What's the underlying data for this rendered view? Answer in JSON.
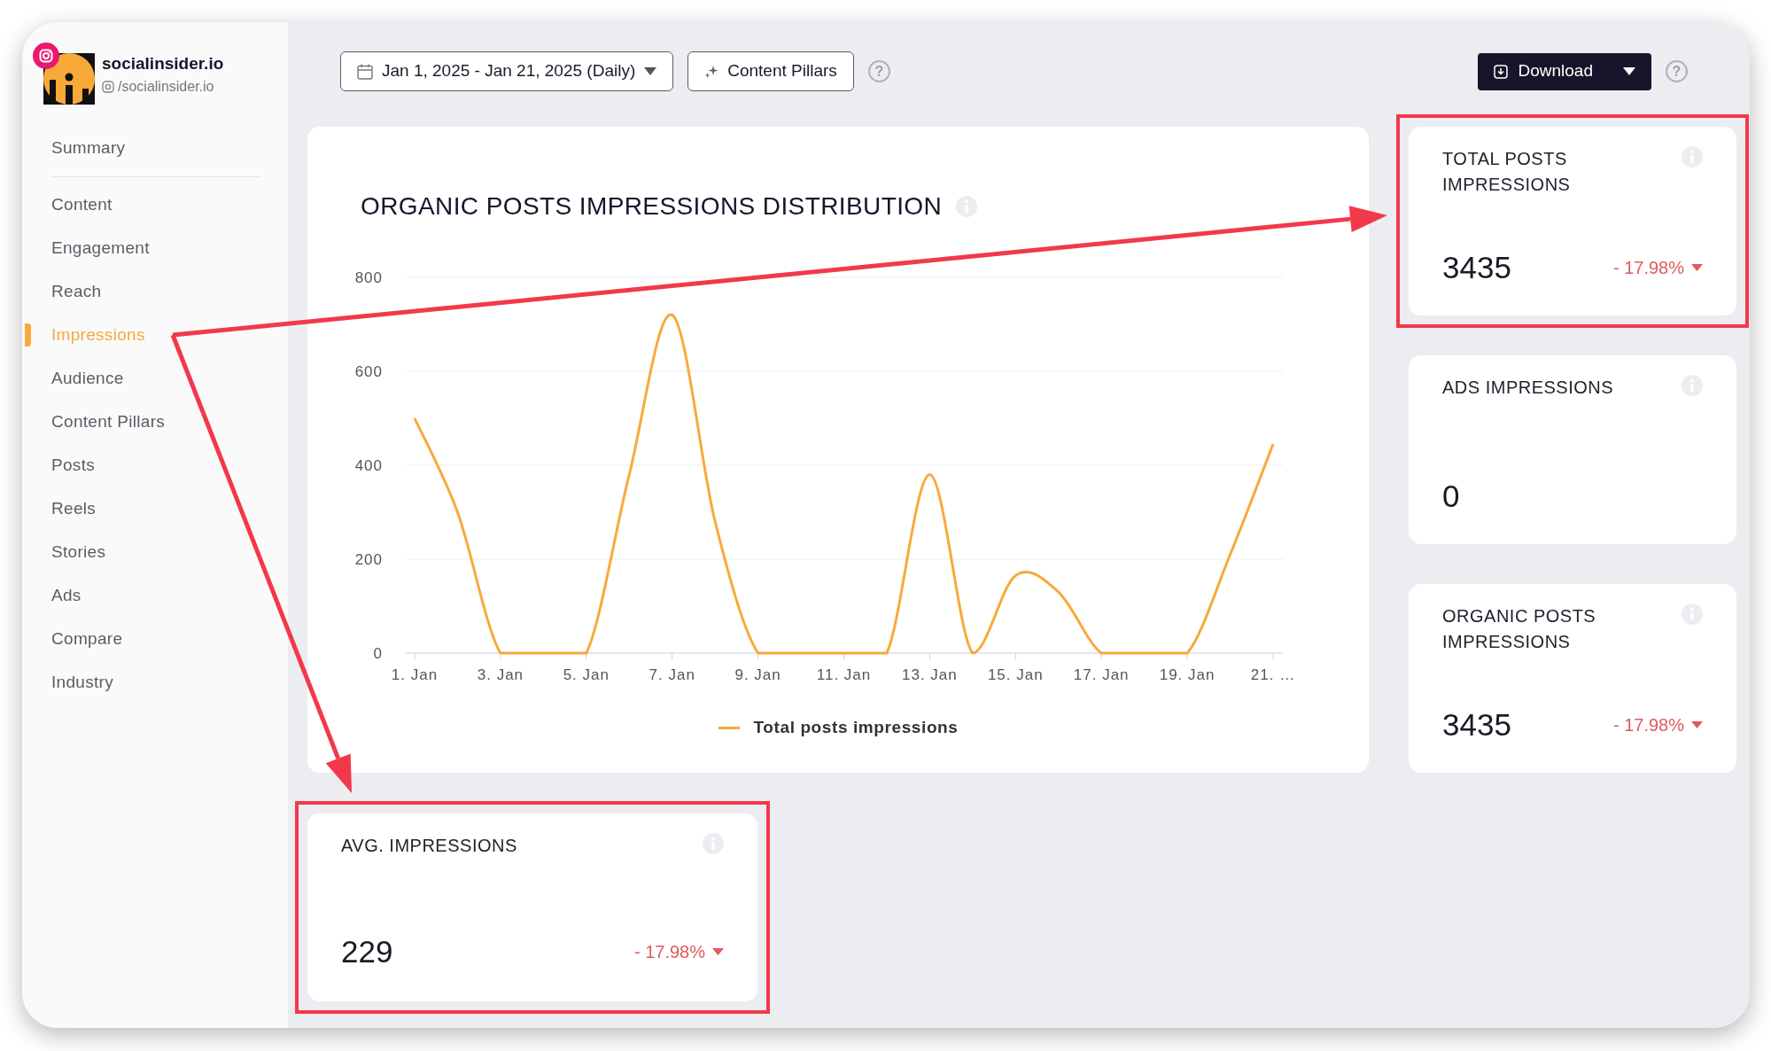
{
  "profile": {
    "name": "socialinsider.io",
    "handle": "/socialinsider.io"
  },
  "sidebar": {
    "items": [
      {
        "label": "Summary",
        "selected": false,
        "divider_after": true
      },
      {
        "label": "Content",
        "selected": false
      },
      {
        "label": "Engagement",
        "selected": false
      },
      {
        "label": "Reach",
        "selected": false
      },
      {
        "label": "Impressions",
        "selected": true
      },
      {
        "label": "Audience",
        "selected": false
      },
      {
        "label": "Content Pillars",
        "selected": false
      },
      {
        "label": "Posts",
        "selected": false
      },
      {
        "label": "Reels",
        "selected": false
      },
      {
        "label": "Stories",
        "selected": false
      },
      {
        "label": "Ads",
        "selected": false
      },
      {
        "label": "Compare",
        "selected": false
      },
      {
        "label": "Industry",
        "selected": false
      }
    ]
  },
  "toolbar": {
    "date_range": "Jan 1, 2025 - Jan 21, 2025 (Daily)",
    "content_pillars": "Content Pillars",
    "help": "?",
    "download": "Download"
  },
  "chart_card": {
    "title": "ORGANIC POSTS IMPRESSIONS DISTRIBUTION",
    "chart_data": {
      "type": "line",
      "categories": [
        "1. Jan",
        null,
        "3. Jan",
        null,
        "5. Jan",
        null,
        "7. Jan",
        null,
        "9. Jan",
        null,
        "11. Jan",
        null,
        "13. Jan",
        null,
        "15. Jan",
        null,
        "17. Jan",
        null,
        "19. Jan",
        null,
        "21. …"
      ],
      "ylim": [
        0,
        800
      ],
      "yticks": [
        0,
        200,
        400,
        600,
        800
      ],
      "grid": true,
      "series": [
        {
          "name": "Total posts impressions",
          "color": "#f8a93a",
          "values": [
            500,
            300,
            0,
            0,
            0,
            380,
            720,
            280,
            0,
            0,
            0,
            0,
            380,
            0,
            165,
            130,
            0,
            0,
            0,
            210,
            445
          ]
        }
      ]
    }
  },
  "metric_cards": [
    {
      "title": "TOTAL POSTS IMPRESSIONS",
      "value": "3435",
      "change": "- 17.98%",
      "highlighted": true
    },
    {
      "title": "ADS IMPRESSIONS",
      "value": "0",
      "highlighted": false
    },
    {
      "title": "ORGANIC POSTS IMPRESSIONS",
      "value": "3435",
      "change": "- 17.98%",
      "highlighted": false
    }
  ],
  "avg_card": {
    "title": "AVG. IMPRESSIONS",
    "value": "229",
    "change": "- 17.98%",
    "highlighted": true
  }
}
